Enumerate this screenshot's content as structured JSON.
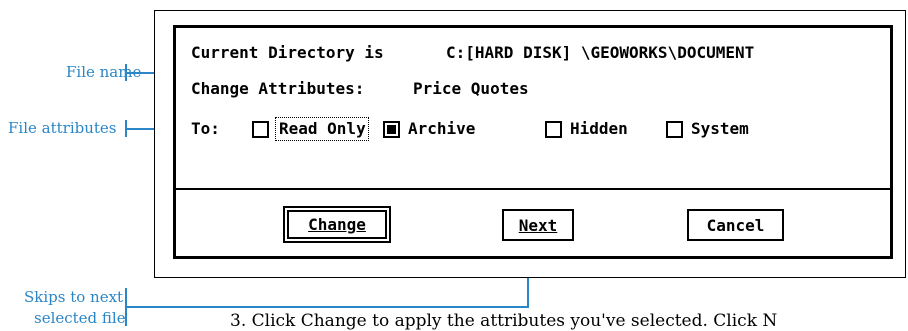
{
  "callouts": {
    "file_name": "File name",
    "file_attributes": "File attributes",
    "skips_line1": "Skips to next",
    "skips_line2": "selected file"
  },
  "dialog": {
    "directory_label": "Current Directory is",
    "directory_path": "C:[HARD DISK] \\GEOWORKS\\DOCUMENT",
    "change_label": "Change Attributes:",
    "file_name": "Price Quotes",
    "to_label": "To:",
    "attributes": [
      {
        "label": "Read Only",
        "checked": false
      },
      {
        "label": "Archive",
        "checked": true
      },
      {
        "label": "Hidden",
        "checked": false
      },
      {
        "label": "System",
        "checked": false
      }
    ],
    "buttons": {
      "change": "Change",
      "next": "Next",
      "cancel": "Cancel"
    }
  },
  "body_text": "3.   Click Change to apply the attributes you've selected. Click N",
  "colors": {
    "callout": "#2a86c6"
  }
}
